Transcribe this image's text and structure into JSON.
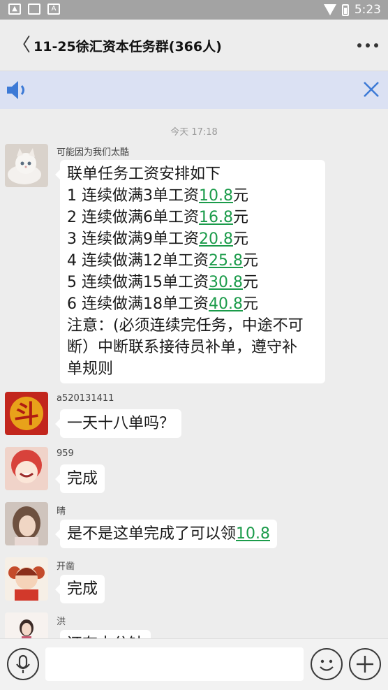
{
  "status_bar": {
    "time": "5:23",
    "icons": [
      "image-icon",
      "image-icon",
      "font-icon",
      "wifi-icon",
      "battery-icon"
    ]
  },
  "header": {
    "back": "〈",
    "title": "11-25徐汇资本任务群(366人)"
  },
  "chat": {
    "timestamp": "今天 17:18",
    "messages": [
      {
        "sender": "可能因为我们太酷",
        "lines": [
          {
            "text": "联单任务工资安排如下",
            "amount": ""
          },
          {
            "text": "1 连续做满3单工资",
            "amount": "10.8",
            "unit": "元"
          },
          {
            "text": "2 连续做满6单工资",
            "amount": "16.8",
            "unit": "元"
          },
          {
            "text": "3 连续做满9单工资",
            "amount": "20.8",
            "unit": "元"
          },
          {
            "text": "4 连续做满12单工资",
            "amount": "25.8",
            "unit": "元"
          },
          {
            "text": "5 连续做满15单工资",
            "amount": "30.8",
            "unit": "元"
          },
          {
            "text": "6 连续做满18单工资",
            "amount": "40.8",
            "unit": "元"
          },
          {
            "text": "注意：(必须连续完任务，中途不可",
            "amount": ""
          },
          {
            "text": "断）中断联系接待员补单，遵守补",
            "amount": ""
          },
          {
            "text": "单规则",
            "amount": ""
          }
        ]
      },
      {
        "sender": "a520131411",
        "text": "一天十八单吗？"
      },
      {
        "sender": "959",
        "text": "完成"
      },
      {
        "sender": "晴",
        "text": "是不是这单完成了可以领",
        "amount": "10.8"
      },
      {
        "sender": "开凿",
        "text": "完成"
      },
      {
        "sender": "洪",
        "text": "还有十分钟"
      }
    ]
  },
  "colors": {
    "link_green": "#1b9b4a",
    "notice_bg": "#dbe1f3",
    "accent_blue": "#3d7ad6"
  }
}
